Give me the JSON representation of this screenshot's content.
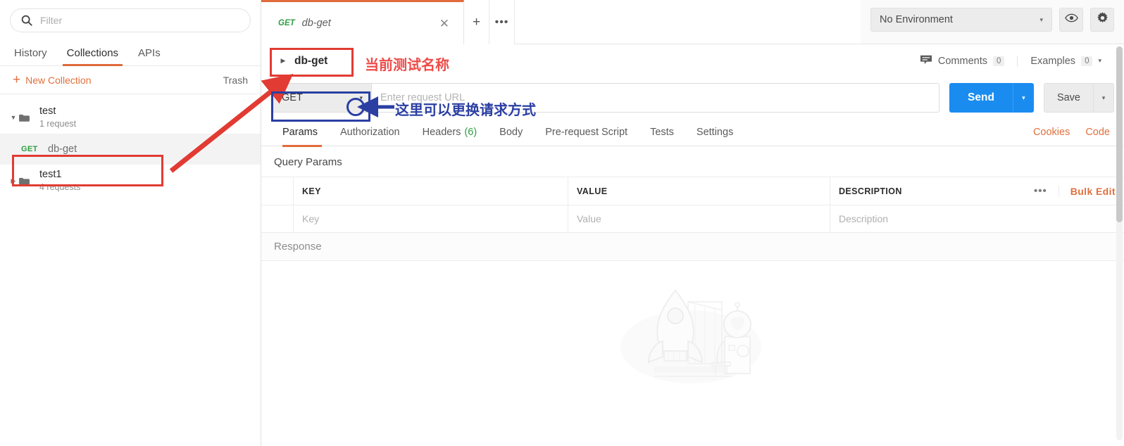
{
  "sidebar": {
    "search": {
      "placeholder": "Filter",
      "value": "",
      "icon": "search-icon"
    },
    "tabs": [
      {
        "label": "History",
        "active": false
      },
      {
        "label": "Collections",
        "active": true
      },
      {
        "label": "APIs",
        "active": false
      }
    ],
    "actions": {
      "new_collection": "New Collection",
      "trash": "Trash",
      "plus": "+"
    },
    "tree": [
      {
        "type": "folder",
        "name": "test",
        "sub": "1 request",
        "expanded": true,
        "caret": "▼"
      },
      {
        "type": "request",
        "method": "GET",
        "name": "db-get",
        "selected": true
      },
      {
        "type": "folder",
        "name": "test1",
        "sub": "4 requests",
        "expanded": false,
        "caret": "▶"
      }
    ]
  },
  "topbar": {
    "tab": {
      "method": "GET",
      "name": "db-get",
      "close": "✕"
    },
    "new_tab": "+",
    "more": "•••",
    "environment": {
      "value": "No Environment",
      "caret": "▾"
    },
    "eye_icon": "eye-icon",
    "gear_icon": "gear-icon"
  },
  "breadcrumb": {
    "caret": "▶",
    "name": "db-get",
    "comments": {
      "label": "Comments",
      "count": "0",
      "icon": "comment-icon"
    },
    "examples": {
      "label": "Examples",
      "count": "0",
      "caret": "▾"
    }
  },
  "url_bar": {
    "method": "GET",
    "method_caret": "▾",
    "url_value": "",
    "url_placeholder": "Enter request URL",
    "send_label": "Send",
    "send_caret": "▾",
    "save_label": "Save",
    "save_caret": "▾"
  },
  "request_tabs": [
    {
      "label": "Params",
      "count": "",
      "active": true
    },
    {
      "label": "Authorization",
      "count": "",
      "active": false
    },
    {
      "label": "Headers",
      "count": "(6)",
      "active": false
    },
    {
      "label": "Body",
      "count": "",
      "active": false
    },
    {
      "label": "Pre-request Script",
      "count": "",
      "active": false
    },
    {
      "label": "Tests",
      "count": "",
      "active": false
    },
    {
      "label": "Settings",
      "count": "",
      "active": false
    }
  ],
  "request_tabs_right": [
    {
      "label": "Cookies"
    },
    {
      "label": "Code"
    }
  ],
  "query_params": {
    "title": "Query Params",
    "columns": [
      "KEY",
      "VALUE",
      "DESCRIPTION"
    ],
    "rows": [
      {
        "key": "Key",
        "value": "Value",
        "description": "Description"
      }
    ],
    "dots": "•••",
    "bulk_edit": "Bulk Edit"
  },
  "response": {
    "title": "Response",
    "illustration": "rocket-astronaut-illustration"
  },
  "annotations": [
    {
      "id": "anno-breadcrumb-box",
      "shape": "rect",
      "color": "#e13b33"
    },
    {
      "id": "anno-sidebar-request-box",
      "shape": "rect",
      "color": "#e13b33"
    },
    {
      "id": "anno-red-arrow",
      "shape": "arrow",
      "color": "#e13b33"
    },
    {
      "id": "anno-method-box",
      "shape": "rect",
      "color": "#2b3fa3"
    },
    {
      "id": "anno-method-circle",
      "shape": "circle",
      "color": "#2b3fa3"
    },
    {
      "id": "anno-blue-arrow",
      "shape": "arrow",
      "color": "#2b3fa3"
    }
  ],
  "annotation_text": {
    "current_test_name": "当前测试名称",
    "change_request_method": "这里可以更换请求方式"
  },
  "colors": {
    "accent_orange": "#e06b3b",
    "send_blue": "#1a8cf0",
    "method_green": "#2f9e44",
    "anno_red": "#e13b33",
    "anno_blue": "#2b3fa3"
  }
}
